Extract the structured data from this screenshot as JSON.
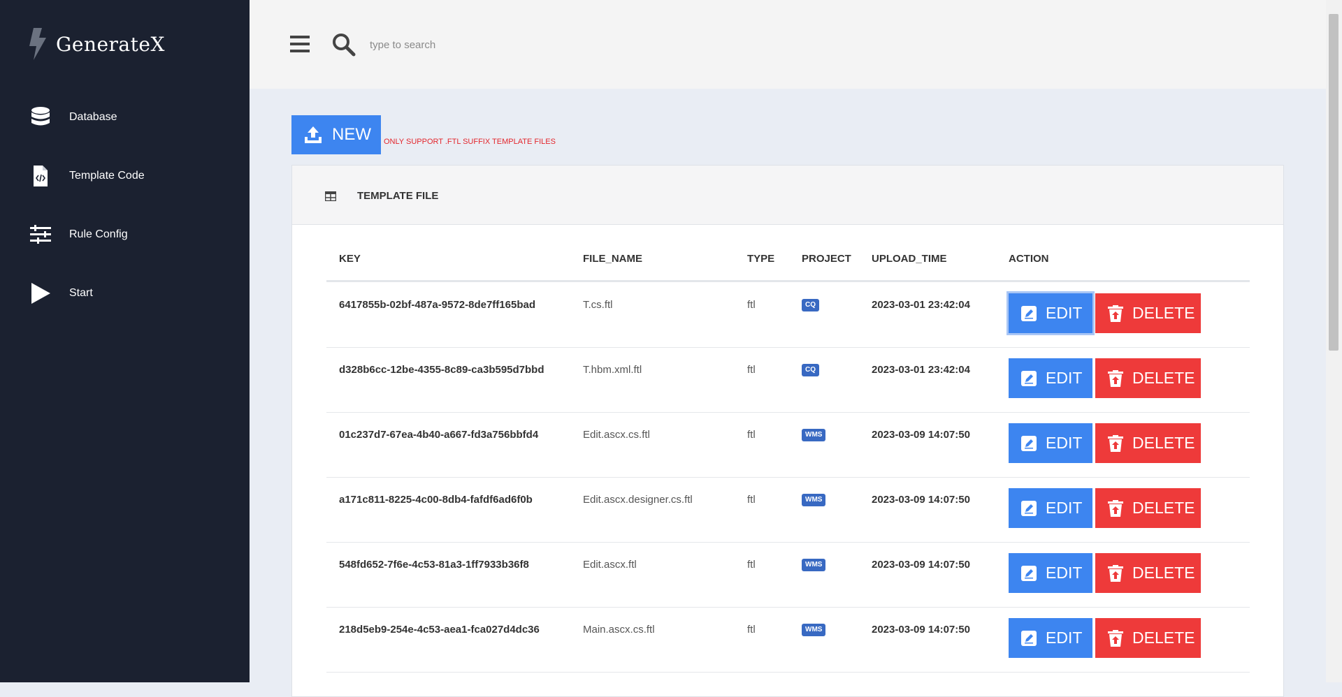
{
  "app": {
    "title": "GenerateX",
    "logo_icon": "lightning-bolt-icon"
  },
  "sidebar": {
    "items": [
      {
        "label": "Database",
        "icon": "database-icon"
      },
      {
        "label": "Template Code",
        "icon": "code-file-icon"
      },
      {
        "label": "Rule Config",
        "icon": "sliders-icon"
      },
      {
        "label": "Start",
        "icon": "play-icon"
      }
    ]
  },
  "topbar": {
    "search_placeholder": "type to search"
  },
  "toolbar": {
    "new_label": "NEW",
    "hint": "ONLY SUPPORT .ftl SUFFIX TEMPLATE FILES"
  },
  "card": {
    "title": "TEMPLATE FILE"
  },
  "table": {
    "columns": [
      "KEY",
      "FILE_NAME",
      "TYPE",
      "PROJECT",
      "UPLOAD_TIME",
      "ACTION"
    ],
    "edit_label": "EDIT",
    "delete_label": "DELETE",
    "rows": [
      {
        "key": "6417855b-02bf-487a-9572-8de7ff165bad",
        "file_name": "T.cs.ftl",
        "type": "ftl",
        "project": "CQ",
        "upload_time": "2023-03-01 23:42:04"
      },
      {
        "key": "d328b6cc-12be-4355-8c89-ca3b595d7bbd",
        "file_name": "T.hbm.xml.ftl",
        "type": "ftl",
        "project": "CQ",
        "upload_time": "2023-03-01 23:42:04"
      },
      {
        "key": "01c237d7-67ea-4b40-a667-fd3a756bbfd4",
        "file_name": "Edit.ascx.cs.ftl",
        "type": "ftl",
        "project": "WMS",
        "upload_time": "2023-03-09 14:07:50"
      },
      {
        "key": "a171c811-8225-4c00-8db4-fafdf6ad6f0b",
        "file_name": "Edit.ascx.designer.cs.ftl",
        "type": "ftl",
        "project": "WMS",
        "upload_time": "2023-03-09 14:07:50"
      },
      {
        "key": "548fd652-7f6e-4c53-81a3-1ff7933b36f8",
        "file_name": "Edit.ascx.ftl",
        "type": "ftl",
        "project": "WMS",
        "upload_time": "2023-03-09 14:07:50"
      },
      {
        "key": "218d5eb9-254e-4c53-aea1-fca027d4dc36",
        "file_name": "Main.ascx.cs.ftl",
        "type": "ftl",
        "project": "WMS",
        "upload_time": "2023-03-09 14:07:50"
      }
    ]
  },
  "colors": {
    "sidebar_bg": "#1b2130",
    "primary": "#3d85f0",
    "danger": "#ee3a3a",
    "badge": "#3869c2"
  }
}
